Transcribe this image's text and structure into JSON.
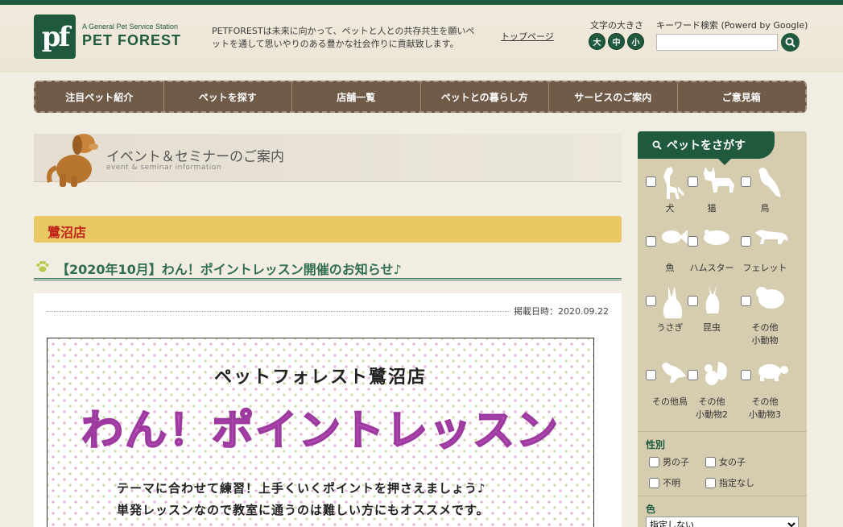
{
  "header": {
    "logo_mark": "pf",
    "logo_sub": "A General Pet Service Station",
    "logo_name": "PET FOREST",
    "tagline": "PETFORESTは未来に向かって、ペットと人との共存共生を願いペットを通して思いやりのある豊かな社会作りに貢献致します。",
    "top_link": "トップページ",
    "font_size_label": "文字の大きさ",
    "font_sizes": [
      "大",
      "中",
      "小"
    ],
    "keyword_label": "キーワード検索 (Powerd by Google)",
    "keyword_placeholder": ""
  },
  "nav": [
    "注目ペット紹介",
    "ペットを探す",
    "店舗一覧",
    "ペットとの暮らし方",
    "サービスのご案内",
    "ご意見箱"
  ],
  "page_head": {
    "title": "イベント＆セミナーのご案内",
    "subtitle": "event & seminar information"
  },
  "store": "鷺沼店",
  "article": {
    "title": "【2020年10月】わん！ポイントレッスン開催のお知らせ♪",
    "date": "掲載日時：2020.09.22"
  },
  "flyer": {
    "store": "ペットフォレスト鷺沼店",
    "title": "わん！ポイントレッスン",
    "line1": "テーマに合わせて練習！上手くいくポイントを押さえましょう♪",
    "line2": "単発レッスンなので教室に通うのは難しい方にもオススメです。"
  },
  "sidebar": {
    "title": "ペットをさがす",
    "pets": [
      {
        "label": "犬",
        "icon": "dog-icon"
      },
      {
        "label": "猫",
        "icon": "cat-icon"
      },
      {
        "label": "鳥",
        "icon": "bird-icon"
      },
      {
        "label": "魚",
        "icon": "fish-icon"
      },
      {
        "label": "ハムスター",
        "icon": "hamster-icon"
      },
      {
        "label": "フェレット",
        "icon": "ferret-icon"
      },
      {
        "label": "うさぎ",
        "icon": "rabbit-icon"
      },
      {
        "label": "昆虫",
        "icon": "beetle-icon"
      },
      {
        "label": "その他\n小動物",
        "icon": "small-animal-icon"
      },
      {
        "label": "その他鳥",
        "icon": "other-bird-icon"
      },
      {
        "label": "その他\n小動物2",
        "icon": "squirrel-icon"
      },
      {
        "label": "その他\n小動物3",
        "icon": "turtle-icon"
      }
    ],
    "sex_title": "性別",
    "sex_options": [
      "男の子",
      "女の子",
      "不明",
      "指定なし"
    ],
    "color_title": "色",
    "color_selected": "指定しない"
  }
}
